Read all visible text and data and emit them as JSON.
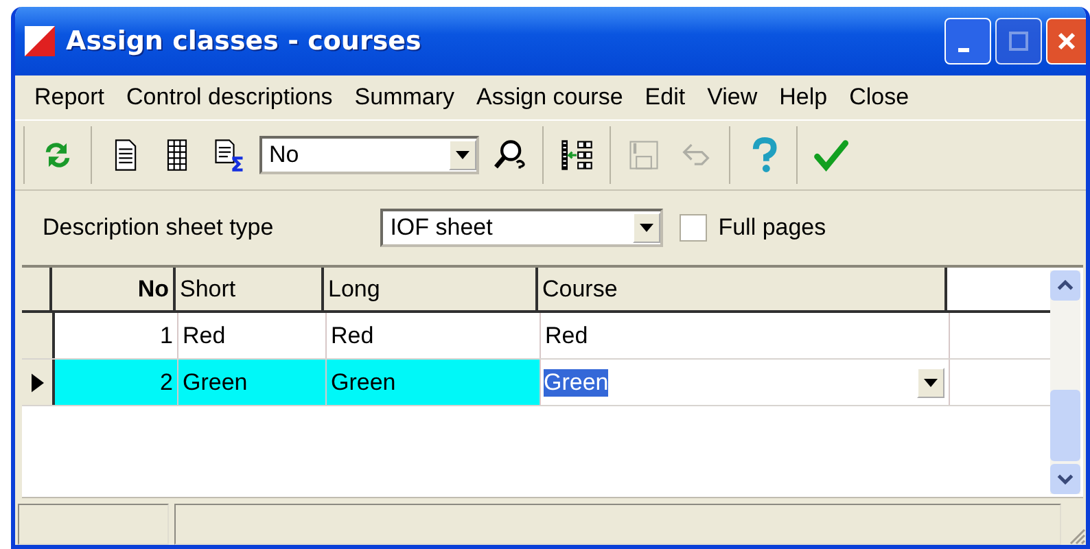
{
  "window": {
    "title": "Assign classes - courses"
  },
  "menu": [
    "Report",
    "Control descriptions",
    "Summary",
    "Assign course",
    "Edit",
    "View",
    "Help",
    "Close"
  ],
  "toolbar": [
    [
      {
        "kind": "refresh",
        "disabled": false
      }
    ],
    [
      {
        "kind": "page",
        "disabled": false
      },
      {
        "kind": "table",
        "disabled": false
      },
      {
        "kind": "sum",
        "disabled": false
      },
      {
        "kind": "combo",
        "value": "No"
      },
      {
        "kind": "search",
        "disabled": false
      }
    ],
    [
      {
        "kind": "columns",
        "disabled": false
      }
    ],
    [
      {
        "kind": "save",
        "disabled": true
      },
      {
        "kind": "undo",
        "disabled": true
      }
    ],
    [
      {
        "kind": "help",
        "disabled": false
      }
    ],
    [
      {
        "kind": "ok",
        "disabled": false
      }
    ]
  ],
  "sheet_type": {
    "label": "Description sheet type",
    "value": "IOF sheet"
  },
  "full_pages": {
    "label": "Full pages",
    "checked": false
  },
  "table": {
    "columns": [
      "No",
      "Short",
      "Long",
      "Course"
    ],
    "rows": [
      {
        "cells": [
          "1",
          "Red",
          "Red",
          "Red"
        ],
        "selected": false
      },
      {
        "cells": [
          "2",
          "Green",
          "Green",
          "Green"
        ],
        "selected": true
      }
    ]
  }
}
